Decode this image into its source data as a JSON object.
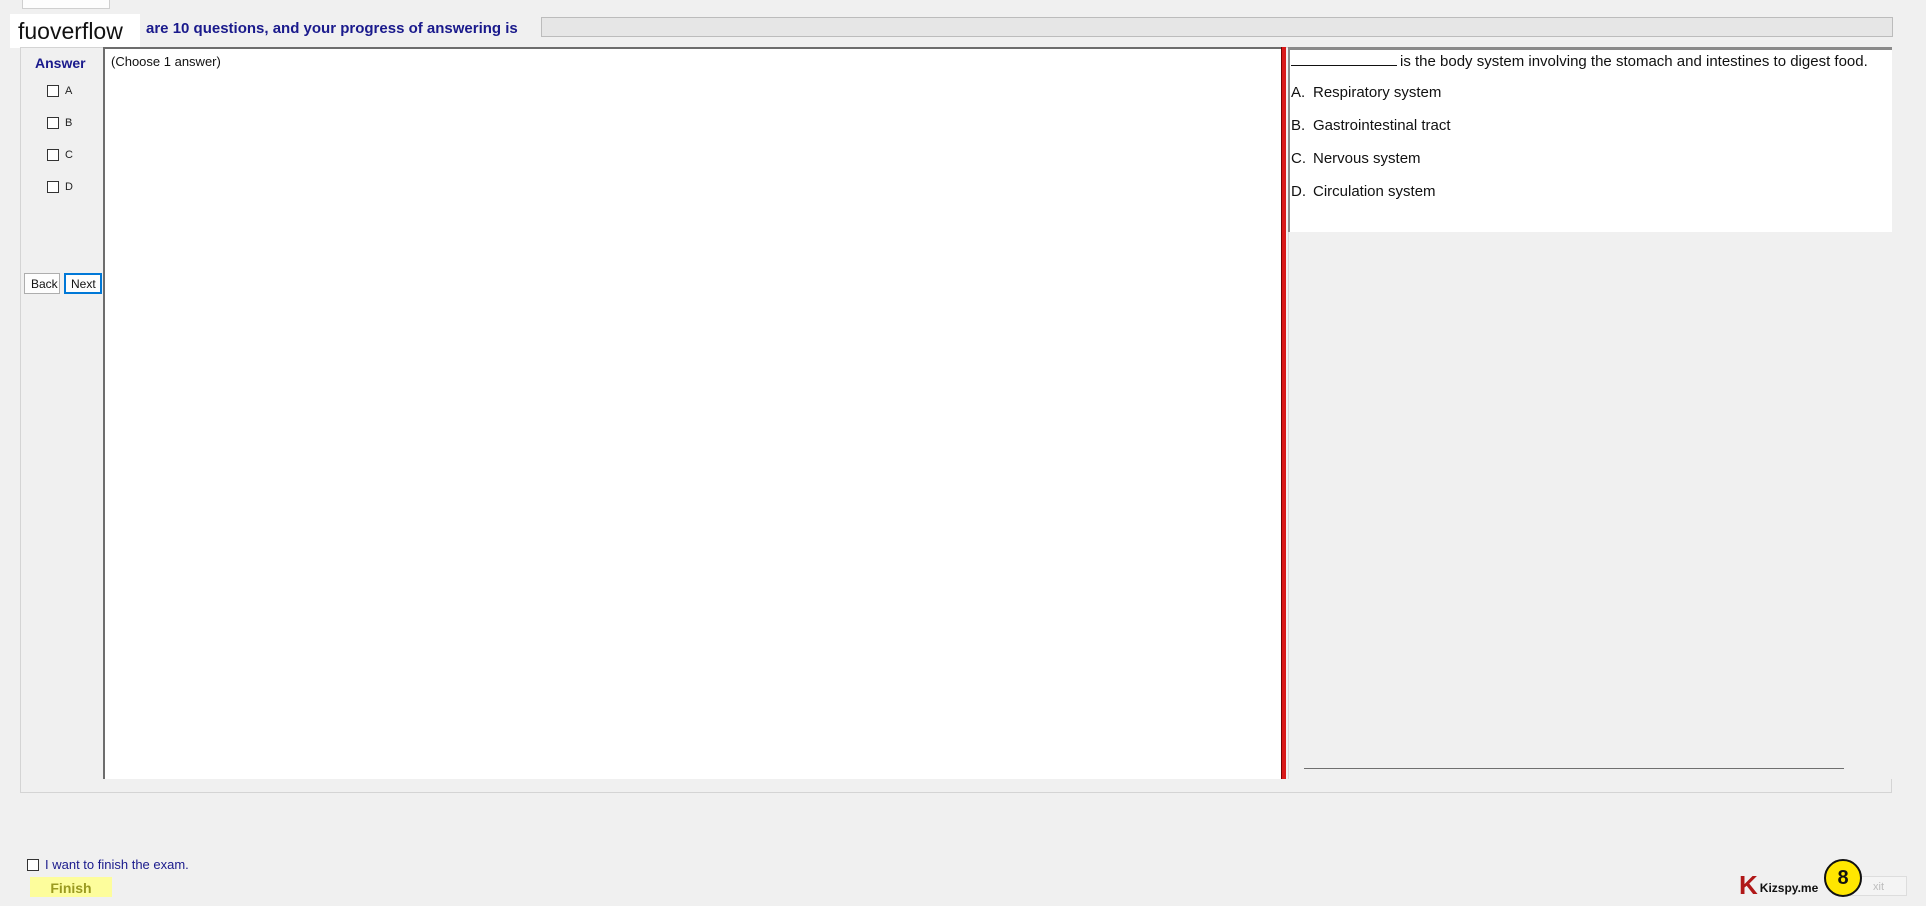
{
  "header": {
    "watermark": "fuoverflow",
    "progress_text": "are 10 questions, and your progress of answering is",
    "progress_fraction": 0
  },
  "answer_panel": {
    "title": "Answer",
    "options": [
      "A",
      "B",
      "C",
      "D"
    ],
    "back_label": "Back",
    "next_label": "Next"
  },
  "instruction": "(Choose 1 answer)",
  "question": {
    "text": "is the body system involving the stomach and intestines to digest food.",
    "choices": [
      {
        "letter": "A.",
        "text": "Respiratory system"
      },
      {
        "letter": "B.",
        "text": "Gastrointestinal tract"
      },
      {
        "letter": "C.",
        "text": "Nervous system"
      },
      {
        "letter": "D.",
        "text": "Circulation system"
      }
    ]
  },
  "footer": {
    "finish_checkbox_label": "I want to finish the exam.",
    "finish_label": "Finish",
    "brand_text": "Kizspy.me",
    "badge_number": "8",
    "exit_label": "xit"
  },
  "colors": {
    "accent": "#1a1a8c",
    "splitter": "#d81818",
    "finish_bg": "#fdfd9c",
    "badge": "#ffe600"
  }
}
